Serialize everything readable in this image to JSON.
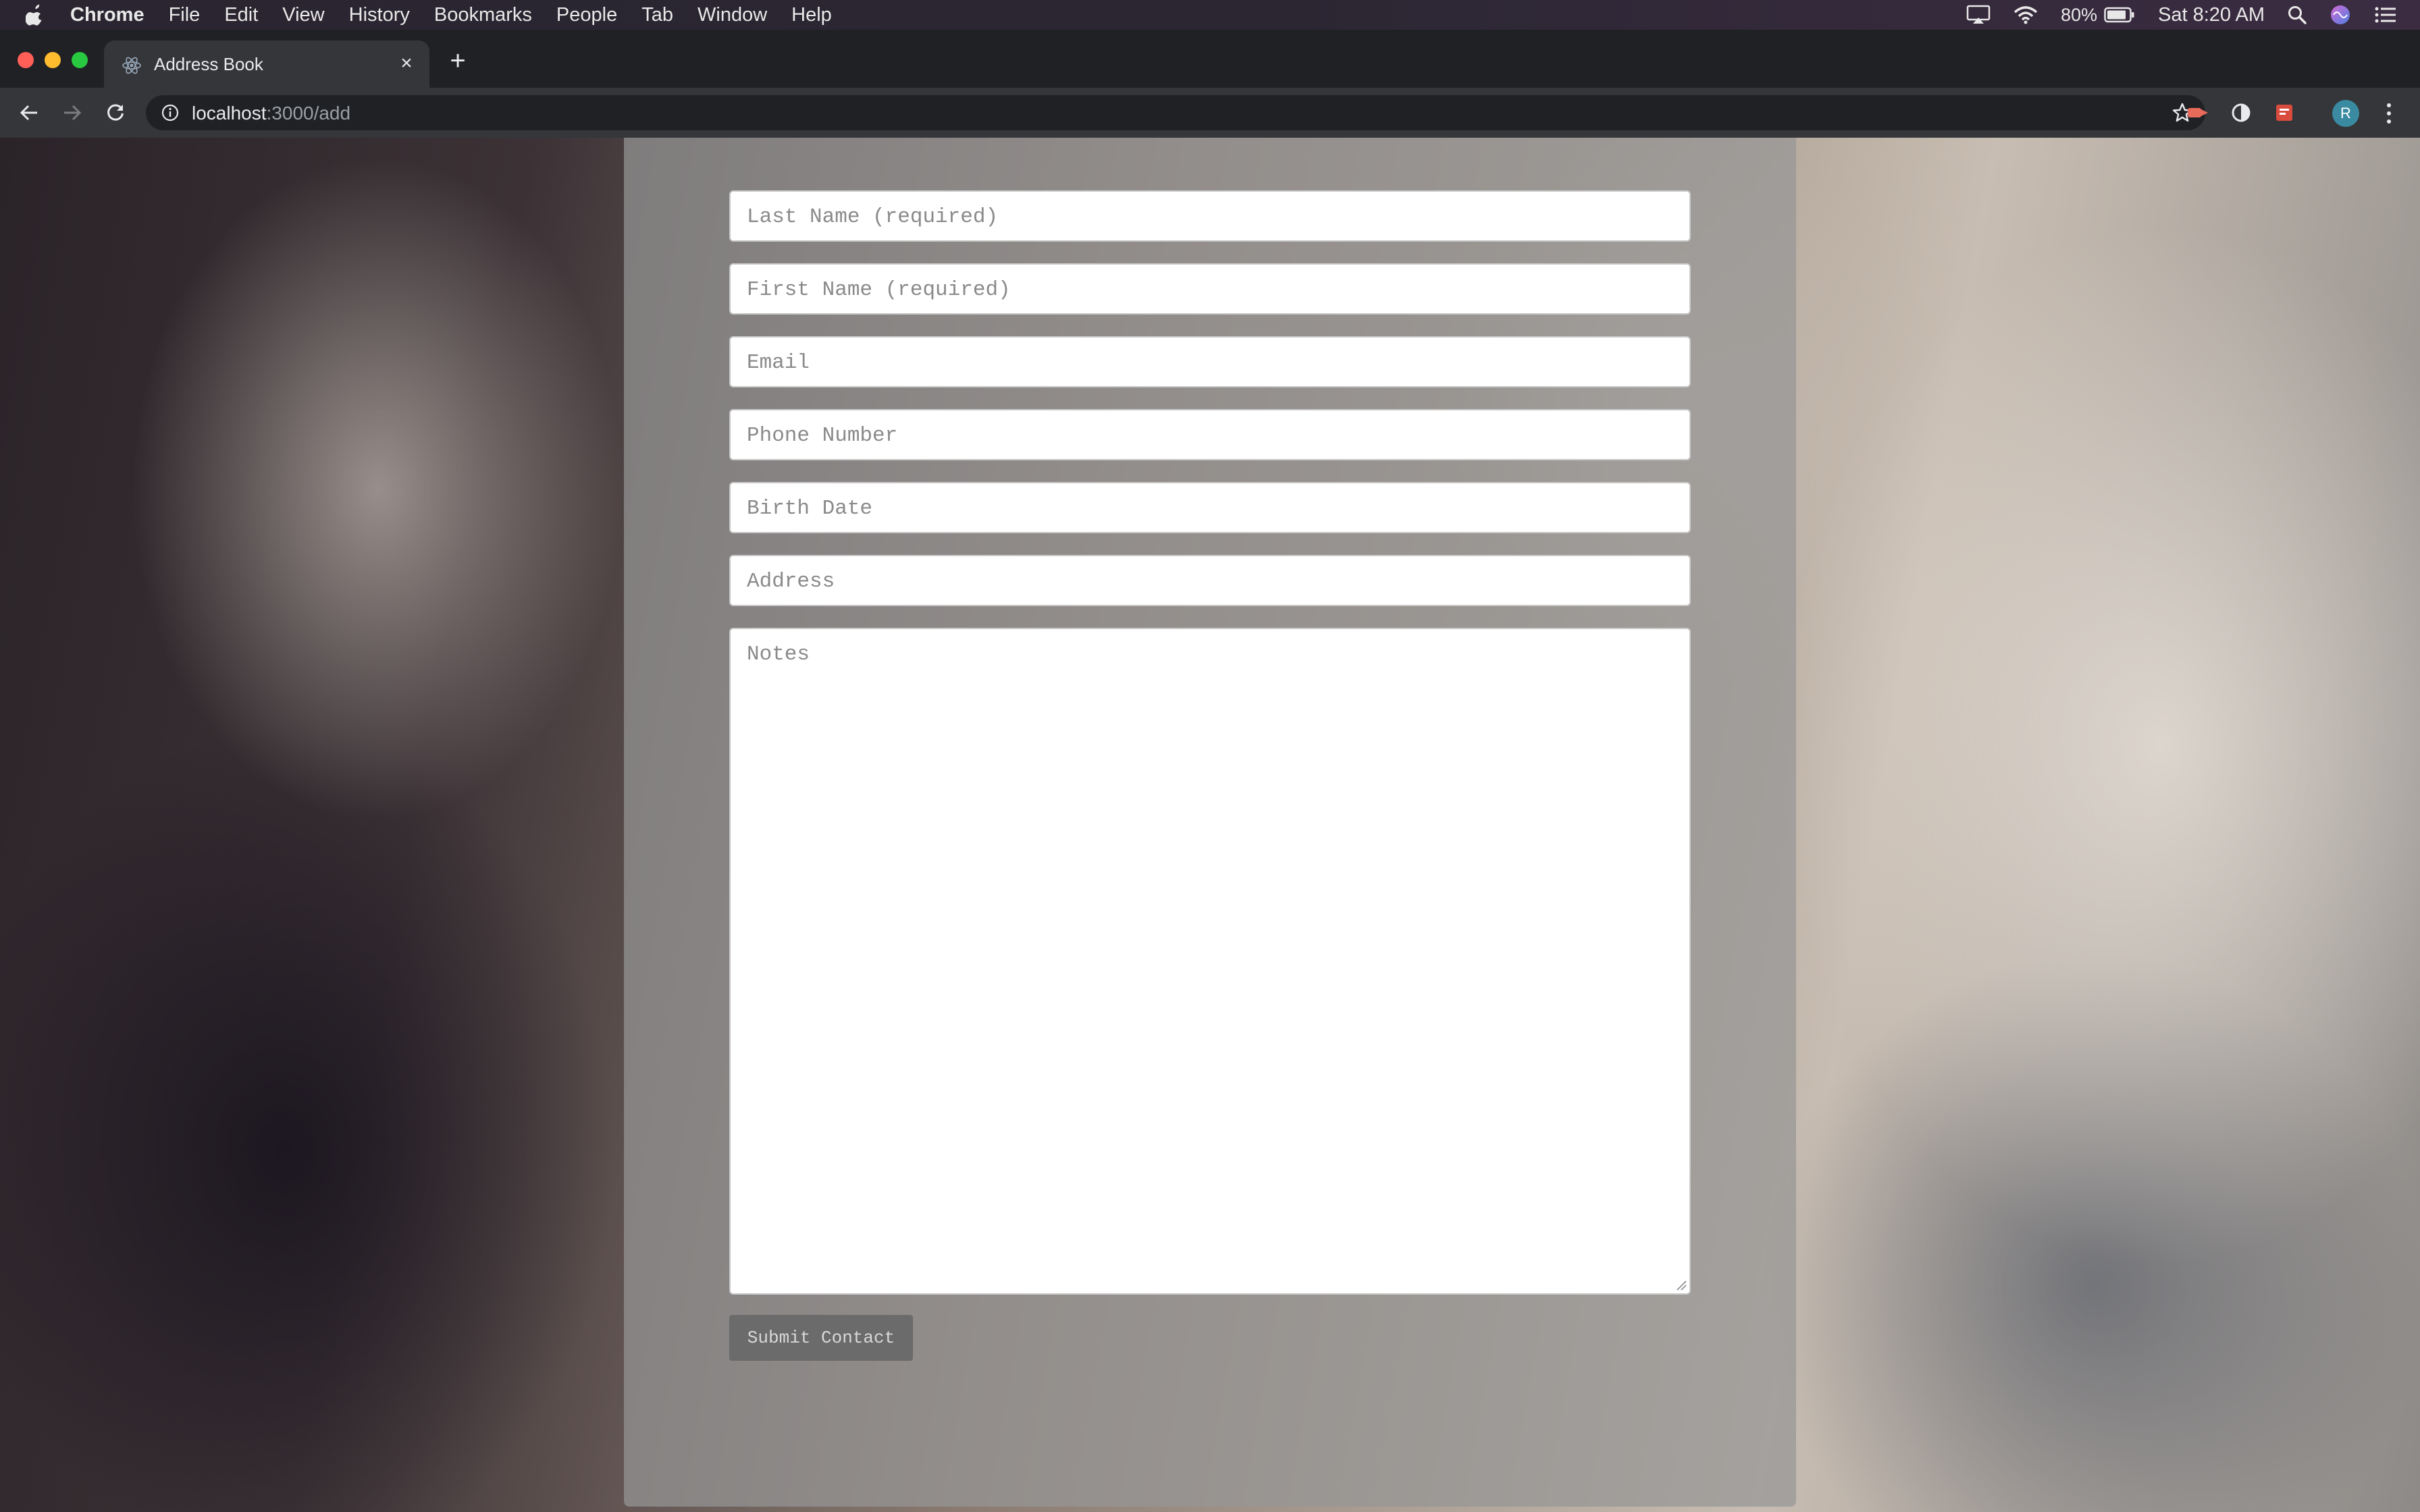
{
  "menubar": {
    "app": "Chrome",
    "items": [
      "File",
      "Edit",
      "View",
      "History",
      "Bookmarks",
      "People",
      "Tab",
      "Window",
      "Help"
    ],
    "battery": "80%",
    "clock": "Sat 8:20 AM"
  },
  "tab": {
    "title": "Address Book",
    "close": "×",
    "new_tab": "+"
  },
  "toolbar": {
    "url_host": "localhost",
    "url_path": ":3000/add",
    "profile_initial": "R"
  },
  "form": {
    "last_name_placeholder": "Last Name (required)",
    "first_name_placeholder": "First Name (required)",
    "email_placeholder": "Email",
    "phone_placeholder": "Phone Number",
    "birth_date_placeholder": "Birth Date",
    "address_placeholder": "Address",
    "notes_placeholder": "Notes",
    "submit_label": "Submit Contact"
  },
  "colors": {
    "accent_profile": "#3a8aa1",
    "panel": "rgba(150,150,150,0.72)",
    "submit_bg": "#6b6b6b"
  }
}
